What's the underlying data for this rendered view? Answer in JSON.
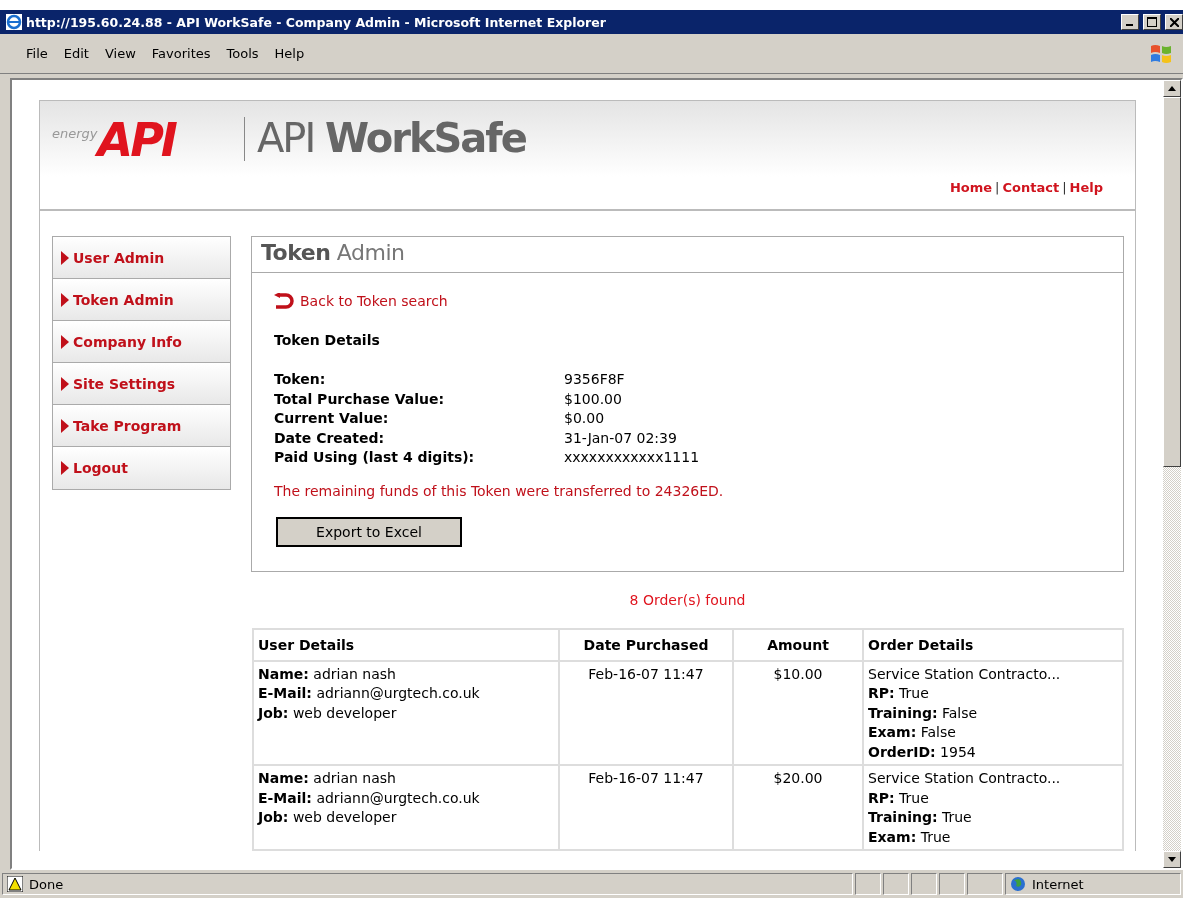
{
  "window": {
    "title": "http://195.60.24.88 - API WorkSafe - Company Admin - Microsoft Internet Explorer"
  },
  "menu": [
    "File",
    "Edit",
    "View",
    "Favorites",
    "Tools",
    "Help"
  ],
  "header": {
    "logo_prefix": "energy",
    "logo": "API",
    "site_title": "API **WorkSafe**",
    "links": [
      "Home",
      "Contact",
      "Help"
    ],
    "link_separator": "|"
  },
  "sidebar": {
    "items": [
      {
        "label": "User Admin"
      },
      {
        "label": "Token Admin"
      },
      {
        "label": "Company Info"
      },
      {
        "label": "Site Settings"
      },
      {
        "label": "Take Program"
      },
      {
        "label": "Logout"
      }
    ]
  },
  "panel": {
    "title": "**Token** Admin",
    "back_link": "Back to Token search",
    "section_title": "Token Details",
    "details": [
      {
        "label": "Token:",
        "value": "9356F8F"
      },
      {
        "label": "Total Purchase Value:",
        "value": "$100.00"
      },
      {
        "label": "Current Value:",
        "value": "$0.00"
      },
      {
        "label": "Date Created:",
        "value": "31-Jan-07 02:39"
      },
      {
        "label": "Paid Using (last 4 digits):",
        "value": "xxxxxxxxxxxx1111"
      }
    ],
    "notice": "The remaining funds of this Token were transferred to 24326ED.",
    "export_button": "Export to Excel"
  },
  "orders": {
    "count": "8 Order(s) found",
    "columns": [
      "User Details",
      "Date Purchased",
      "Amount",
      "Order Details"
    ],
    "rows": [
      {
        "user": [
          {
            "label": "Name:",
            "value": "adrian nash"
          },
          {
            "label": "E-Mail:",
            "value": "adriann@urgtech.co.uk"
          },
          {
            "label": "Job:",
            "value": "web developer"
          }
        ],
        "date": "Feb-16-07 11:47",
        "amount": "$10.00",
        "product": "Service Station Contracto...",
        "details": [
          {
            "label": "RP:",
            "value": "True"
          },
          {
            "label": "Training:",
            "value": "False"
          },
          {
            "label": "Exam:",
            "value": "False"
          },
          {
            "label": "OrderID:",
            "value": "1954"
          }
        ]
      },
      {
        "user": [
          {
            "label": "Name:",
            "value": "adrian nash"
          },
          {
            "label": "E-Mail:",
            "value": "adriann@urgtech.co.uk"
          },
          {
            "label": "Job:",
            "value": "web developer"
          }
        ],
        "date": "Feb-16-07 11:47",
        "amount": "$20.00",
        "product": "Service Station Contracto...",
        "details": [
          {
            "label": "RP:",
            "value": "True"
          },
          {
            "label": "Training:",
            "value": "True"
          },
          {
            "label": "Exam:",
            "value": "True"
          }
        ]
      }
    ]
  },
  "status_bar": {
    "text": "Done",
    "zone": "Internet"
  }
}
